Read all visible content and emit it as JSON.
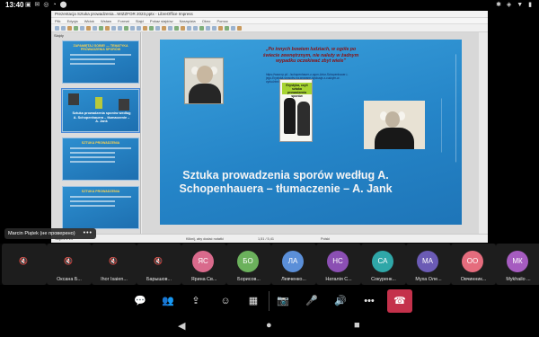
{
  "status_bar": {
    "time": "13:40",
    "left_icons": "▣ ✉ ◎ ◔ ⬤",
    "right_icons": "✱ ◈ ▼ ▮"
  },
  "shared_screen": {
    "window_title": "Prezentacja Sztuka prowadzenia...WIZZFOR 2023.pptx - LibreOffice Impress",
    "menu": [
      "Plik",
      "Edycja",
      "Widok",
      "Wstaw",
      "Format",
      "Slajd",
      "Pokaz slajdów",
      "Narzędzia",
      "Okno",
      "Pomoc"
    ],
    "slides_pane_label": "Slajdy",
    "thumbnails": [
      {
        "num": "",
        "title": "ZAPAMIĘTAJ SOBIE! — TEMATYKA PROWADZENIA SPORÓW",
        "text": "",
        "selected": false
      },
      {
        "num": "",
        "title": "",
        "text": "Sztuka prowadzenia sporów według A. Schopenhauera – tłumaczenie – A. Jank",
        "selected": true
      },
      {
        "num": "",
        "title": "SZTUKA PROWADZENIA",
        "text": "",
        "selected": false
      },
      {
        "num": "",
        "title": "SZTUKA PROWADZENIA",
        "text": "",
        "selected": false
      }
    ],
    "slide": {
      "quote": "„Po innych bowiem ludziach, w ogóle po świecie zewnętrznym, nie należy w żadnym wypadku oczekiwać zbyt wiele”",
      "link": "https://www.rp.pl/.../schopenhauer-z-ogon-Artur-Schopenhauer-i-jego-Erystyka-sposoby-na-wygrane-dyskusje-z-cudzym-w-cyrku.html",
      "book_title": "Erystyka, czyli sztuka prowadzenia sporów",
      "title": "Sztuka prowadzenia sporów według A. Schopenhauera – tłumaczenie – A. Jank"
    },
    "status": {
      "left": "Slajd 2 z 14",
      "middle": "Kliknij, aby dodać notatki",
      "lang": "Polski",
      "right": "1,51 / 5,41"
    }
  },
  "presenter_label": "Marcin Piątek (не проверено)",
  "participants": [
    {
      "initials": "",
      "name": "",
      "color": "#1d1d1d"
    },
    {
      "initials": "",
      "name": "Оксана Б...",
      "color": "#1d1d1d"
    },
    {
      "initials": "",
      "name": "Ihor Isaien...",
      "color": "#1d1d1d"
    },
    {
      "initials": "",
      "name": "Барышов...",
      "color": "#1d1d1d"
    },
    {
      "initials": "ЯС",
      "name": "Ярина Св...",
      "color": "#d96a8c"
    },
    {
      "initials": "БО",
      "name": "Борисов...",
      "color": "#6bb15c"
    },
    {
      "initials": "ЛА",
      "name": "Левченко...",
      "color": "#5b8fd8"
    },
    {
      "initials": "НС",
      "name": "Наталія С...",
      "color": "#8b4fb3"
    },
    {
      "initials": "СА",
      "name": "Сокуренк...",
      "color": "#2fa7a8"
    },
    {
      "initials": "МА",
      "name": "Муха Оле...",
      "color": "#6b5bb5"
    },
    {
      "initials": "ОО",
      "name": "Овчинник...",
      "color": "#e56c7d"
    },
    {
      "initials": "МК",
      "name": "Mykhailo ...",
      "color": "#a65cc0"
    }
  ],
  "controls": {
    "chat": "💬",
    "people": "👥",
    "share": "⇪",
    "reactions": "☺",
    "rooms": "▦",
    "camera": "📷",
    "mic": "🎤",
    "speaker": "🔊",
    "more": "•••",
    "leave": "☎"
  },
  "nav": {
    "back": "◀",
    "home": "●",
    "recents": "■"
  }
}
